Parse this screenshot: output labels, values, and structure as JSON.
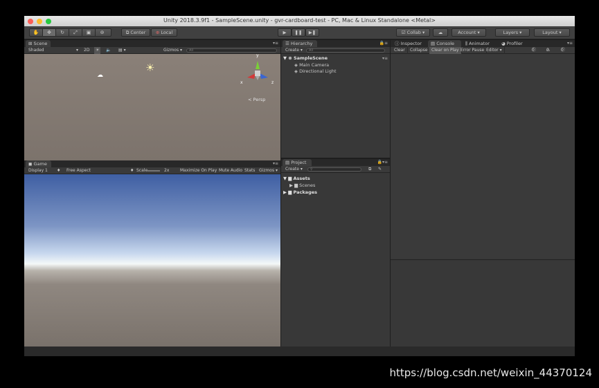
{
  "window": {
    "title": "Unity 2018.3.9f1 - SampleScene.unity - gvr-cardboard-test - PC, Mac & Linux Standalone <Metal>"
  },
  "toolbar": {
    "pivot_label": "Center",
    "space_label": "Local",
    "collab_label": "Collab ▾",
    "account_label": "Account ▾",
    "layers_label": "Layers ▾",
    "layout_label": "Layout ▾"
  },
  "scene": {
    "tab_label": "Scene",
    "shading": "Shaded",
    "mode_2d": "2D",
    "gizmos_label": "Gizmos ▾",
    "search_placeholder": "All",
    "persp_label": "< Persp",
    "axis_x": "x",
    "axis_y": "y",
    "axis_z": "z"
  },
  "game": {
    "tab_label": "Game",
    "display": "Display 1",
    "aspect": "Free Aspect",
    "scale_label": "Scale",
    "scale_value": "2x",
    "maximize_label": "Maximize On Play",
    "mute_label": "Mute Audio",
    "stats_label": "Stats",
    "gizmos_label": "Gizmos ▾"
  },
  "hierarchy": {
    "tab_label": "Hierarchy",
    "create_label": "Create ▾",
    "search_placeholder": "All",
    "scene_name": "SampleScene",
    "items": [
      "Main Camera",
      "Directional Light"
    ]
  },
  "project": {
    "tab_label": "Project",
    "create_label": "Create ▾",
    "assets_label": "Assets",
    "scenes_label": "Scenes",
    "packages_label": "Packages"
  },
  "right": {
    "tabs": [
      "Inspector",
      "Console",
      "Animator",
      "Profiler"
    ],
    "console_buttons": [
      "Clear",
      "Collapse",
      "Clear on Play",
      "Error Pause",
      "Editor ▾"
    ],
    "counts": [
      "0",
      "0",
      "0"
    ]
  },
  "watermark": "https://blog.csdn.net/weixin_44370124"
}
